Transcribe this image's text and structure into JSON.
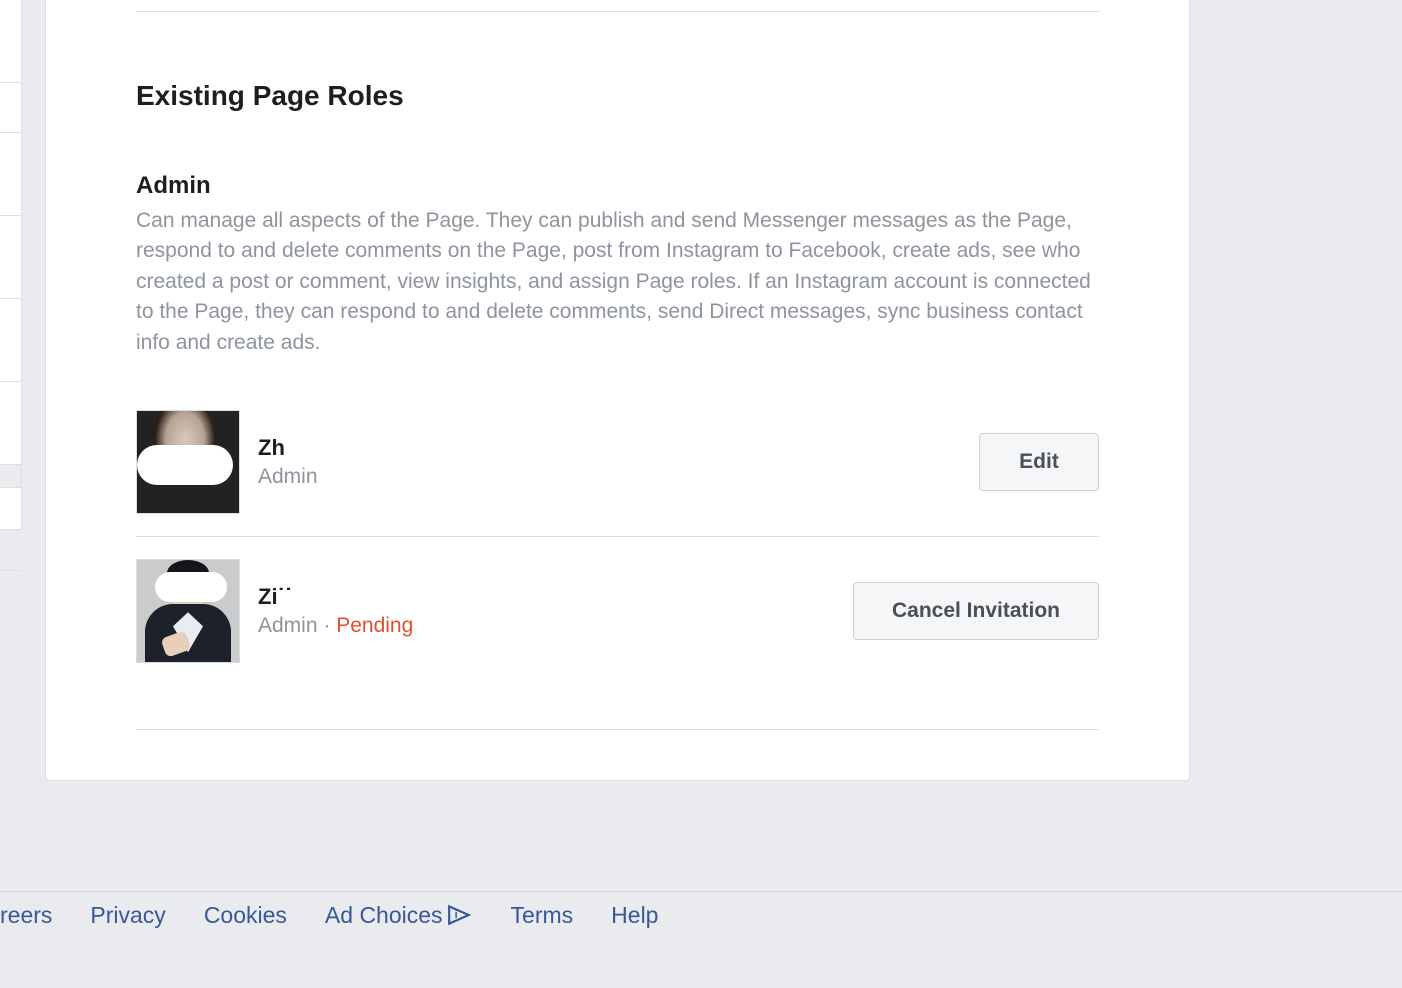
{
  "section_title": "Existing Page Roles",
  "role_group": {
    "title": "Admin",
    "description": "Can manage all aspects of the Page. They can publish and send Messenger messages as the Page, respond to and delete comments on the Page, post from Instagram to Facebook, create ads, see who created a post or comment, view insights, and assign Page roles. If an Instagram account is connected to the Page, they can respond to and delete comments, send Direct messages, sync business contact info and create ads."
  },
  "roles": [
    {
      "name": "Zh",
      "role": "Admin",
      "status": "",
      "action": "Edit"
    },
    {
      "name": "Zi˙˙",
      "role": "Admin",
      "status": "Pending",
      "action": "Cancel Invitation"
    }
  ],
  "footer": {
    "careers": "reers",
    "privacy": "Privacy",
    "cookies": "Cookies",
    "ad_choices": "Ad Choices",
    "terms": "Terms",
    "help": "Help"
  }
}
